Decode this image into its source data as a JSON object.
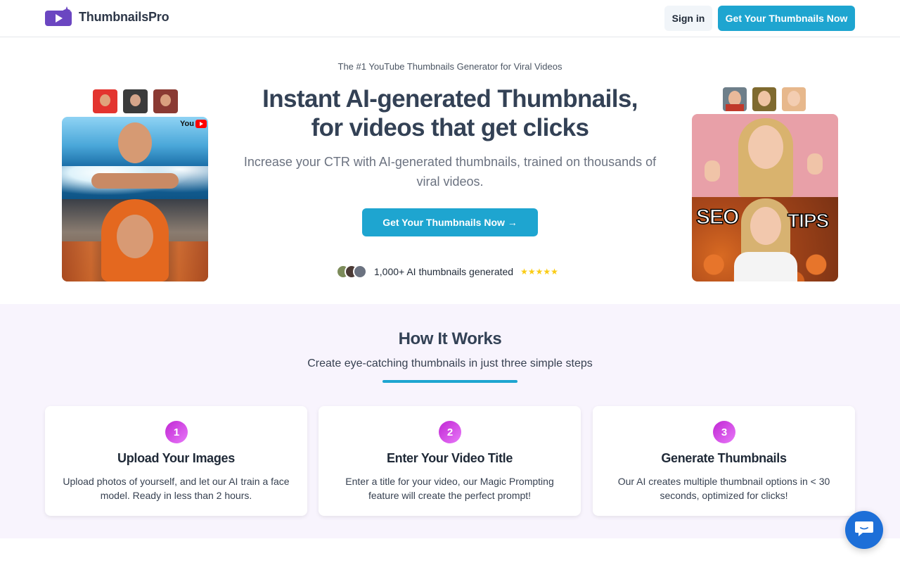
{
  "header": {
    "brand": "ThumbnailsPro",
    "signin_label": "Sign in",
    "cta_label": "Get Your Thumbnails Now"
  },
  "hero": {
    "tagline": "The #1 YouTube Thumbnails Generator for Viral Videos",
    "headline_line1": "Instant AI-generated Thumbnails,",
    "headline_line2": "for videos that get clicks",
    "subheadline": "Increase your CTR with AI-generated thumbnails, trained on thousands of viral videos.",
    "cta_label": "Get Your Thumbnails Now →",
    "proof_text": "1,000+ AI thumbnails generated",
    "stars": "★★★★★",
    "left_badge": "You",
    "right_overlay_left": "SEO",
    "right_overlay_right": "TIPS"
  },
  "how": {
    "title": "How It Works",
    "subtitle": "Create eye-catching thumbnails in just three simple steps",
    "steps": [
      {
        "num": "1",
        "title": "Upload Your Images",
        "desc": "Upload photos of yourself, and let our AI train a face model. Ready in less than 2 hours."
      },
      {
        "num": "2",
        "title": "Enter Your Video Title",
        "desc": "Enter a title for your video, our Magic Prompting feature will create the perfect prompt!"
      },
      {
        "num": "3",
        "title": "Generate Thumbnails",
        "desc": "Our AI creates multiple thumbnail options in < 30 seconds, optimized for clicks!"
      }
    ]
  },
  "colors": {
    "accent": "#1ea5d0",
    "brand_purple": "#6b46c1",
    "section_bg": "#f8f4fd",
    "step_badge": "#d946ef"
  }
}
